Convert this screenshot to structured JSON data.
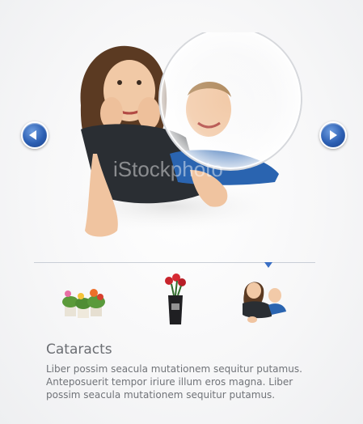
{
  "slider": {
    "prev_icon": "chevron-left-icon",
    "next_icon": "chevron-right-icon",
    "watermark": "iStockphoto",
    "accent_color": "#2c5fb3"
  },
  "thumbnails": [
    {
      "name": "flower-pots",
      "selected": false
    },
    {
      "name": "red-flowers-vase",
      "selected": false
    },
    {
      "name": "kids-portrait",
      "selected": true
    }
  ],
  "caption": {
    "title": "Cataracts",
    "text": "Liber possim seacula mutationem sequitur putamus. Anteposuerit tempor iriure illum eros magna. Liber possim seacula mutationem sequitur putamus."
  }
}
